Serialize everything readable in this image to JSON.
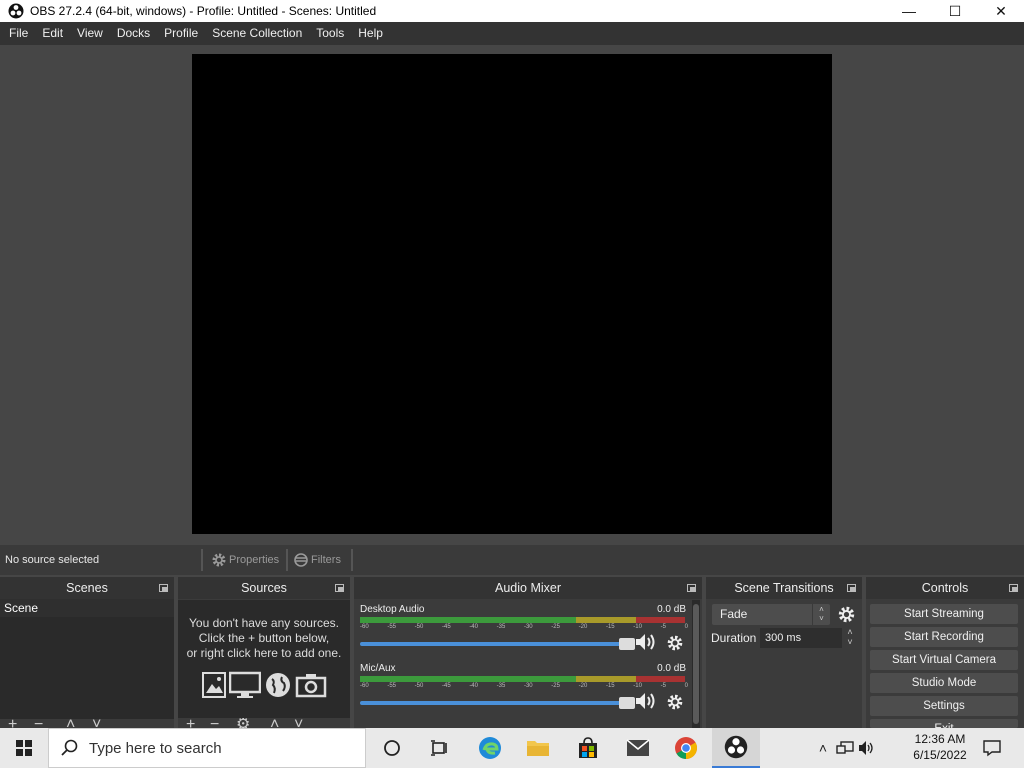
{
  "window": {
    "title": "OBS 27.2.4 (64-bit, windows) - Profile: Untitled - Scenes: Untitled",
    "minimize": "—",
    "maximize": "☐",
    "close": "✕"
  },
  "menu": [
    "File",
    "Edit",
    "View",
    "Docks",
    "Profile",
    "Scene Collection",
    "Tools",
    "Help"
  ],
  "context_bar": {
    "status": "No source selected",
    "properties_label": "Properties",
    "filters_label": "Filters"
  },
  "docks": {
    "scenes": {
      "title": "Scenes",
      "items": [
        "Scene"
      ]
    },
    "sources": {
      "title": "Sources",
      "empty_line1": "You don't have any sources.",
      "empty_line2": "Click the + button below,",
      "empty_line3": "or right click here to add one."
    },
    "audio_mixer": {
      "title": "Audio Mixer",
      "ticks": [
        "-60",
        "-55",
        "-50",
        "-45",
        "-40",
        "-35",
        "-30",
        "-25",
        "-20",
        "-15",
        "-10",
        "-5",
        "0"
      ],
      "channels": [
        {
          "name": "Desktop Audio",
          "db": "0.0 dB",
          "volume_fraction": 1.0
        },
        {
          "name": "Mic/Aux",
          "db": "0.0 dB",
          "volume_fraction": 1.0
        }
      ]
    },
    "scene_transitions": {
      "title": "Scene Transitions",
      "transition": "Fade",
      "duration_label": "Duration",
      "duration_value": "300 ms"
    },
    "controls": {
      "title": "Controls",
      "buttons": [
        "Start Streaming",
        "Start Recording",
        "Start Virtual Camera",
        "Studio Mode",
        "Settings",
        "Exit"
      ]
    }
  },
  "taskbar": {
    "search_placeholder": "Type here to search",
    "time": "12:36 AM",
    "date": "6/15/2022"
  },
  "colors": {
    "background": "#464646",
    "dock_title": "#333333",
    "slider": "#4a90d9",
    "meter_green": "#3c9a3c",
    "meter_yellow": "#a89a2a",
    "meter_red": "#a83232"
  }
}
